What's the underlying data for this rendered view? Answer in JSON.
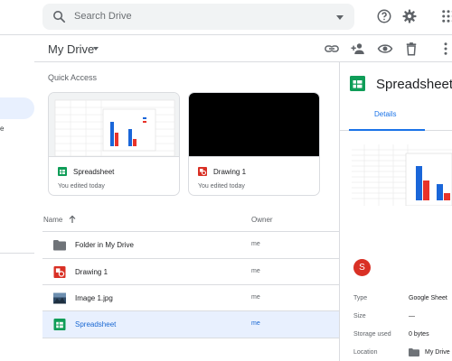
{
  "search": {
    "placeholder": "Search Drive"
  },
  "toolbar": {
    "help_icon": "help-icon",
    "settings_icon": "gear-icon",
    "apps_icon": "apps-grid-icon"
  },
  "sidebar": {
    "fragment_text": "e"
  },
  "header": {
    "title": "My Drive",
    "actions": [
      "link-icon",
      "add-person-icon",
      "eye-icon",
      "trash-icon",
      "more-vert-icon"
    ]
  },
  "quick_access": {
    "title": "Quick Access",
    "cards": [
      {
        "name": "Spreadsheet",
        "subtitle": "You edited today",
        "icon": "sheets-icon"
      },
      {
        "name": "Drawing 1",
        "subtitle": "You edited today",
        "icon": "drawing-icon"
      }
    ]
  },
  "file_list": {
    "columns": {
      "name": "Name",
      "owner": "Owner"
    },
    "rows": [
      {
        "name": "Folder in My Drive",
        "owner": "me",
        "icon": "folder-icon",
        "selected": false
      },
      {
        "name": "Drawing 1",
        "owner": "me",
        "icon": "drawing-icon",
        "selected": false
      },
      {
        "name": "Image 1.jpg",
        "owner": "me",
        "icon": "image-icon",
        "selected": false
      },
      {
        "name": "Spreadsheet",
        "owner": "me",
        "icon": "sheets-icon",
        "selected": true
      }
    ]
  },
  "details": {
    "title": "Spreadsheet",
    "tab": "Details",
    "avatar_letter": "S",
    "properties": [
      {
        "label": "Type",
        "value": "Google Sheet"
      },
      {
        "label": "Size",
        "value": "—"
      },
      {
        "label": "Storage used",
        "value": "0 bytes"
      },
      {
        "label": "Location",
        "value": "My Drive"
      }
    ]
  },
  "colors": {
    "accent": "#1a73e8",
    "selected_row": "#e8f0fe",
    "sheets_green": "#0f9d58",
    "drawing_red": "#d93025",
    "chart_blue": "#1a66d9",
    "chart_red": "#e8332a"
  }
}
